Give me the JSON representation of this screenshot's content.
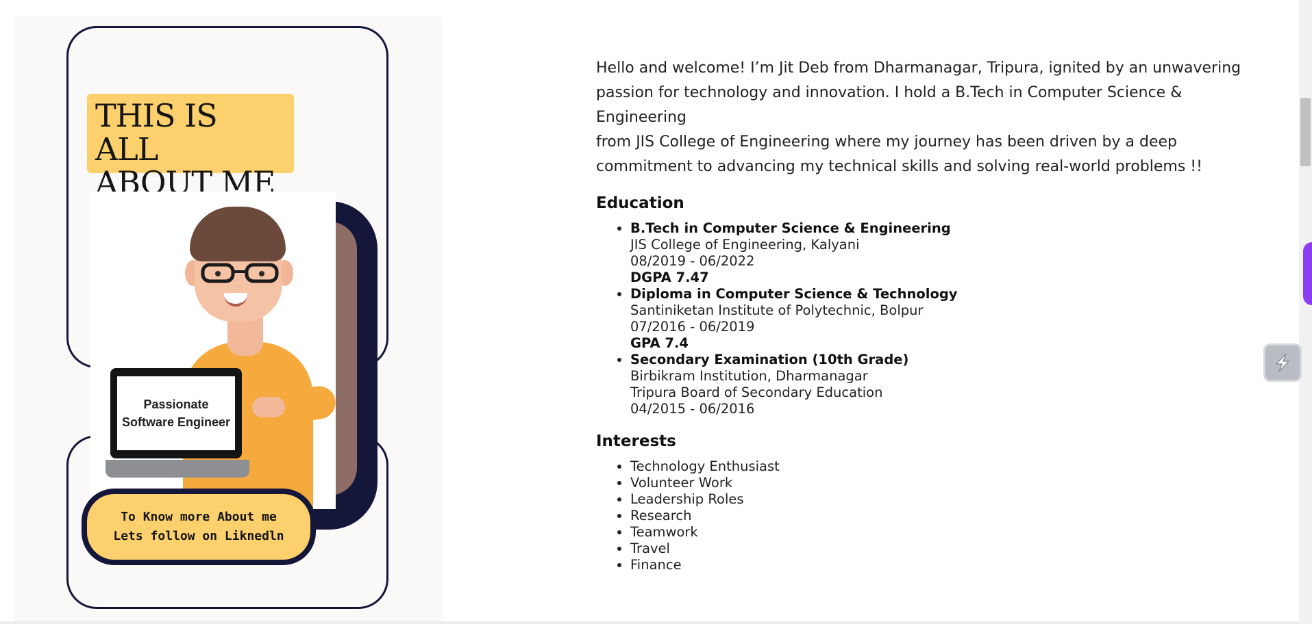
{
  "poster": {
    "headline": "THIS IS ALL\nABOUT ME !!",
    "laptop_text": "Passionate\nSoftware Engineer",
    "cta_text": "To Know more About me\nLets follow on Liknedln"
  },
  "about": {
    "intro_line1": "Hello and welcome! I’m Jit Deb from Dharmanagar, Tripura, ignited by an unwavering passion for technology and innovation. I hold a B.Tech in Computer Science & Engineering",
    "intro_line2": "from JIS College of Engineering where my journey has been driven by a deep commitment to advancing my technical skills and solving real-world problems !!"
  },
  "education": {
    "title": "Education",
    "items": [
      {
        "degree": "B.Tech in Computer Science & Engineering",
        "institution": "JIS College of Engineering, Kalyani",
        "dates": "08/2019 - 06/2022",
        "grade": "DGPA 7.47"
      },
      {
        "degree": "Diploma in Computer Science & Technology",
        "institution": "Santiniketan Institute of Polytechnic, Bolpur",
        "dates": "07/2016 - 06/2019",
        "grade": "GPA 7.4"
      },
      {
        "degree": "Secondary Examination (10th Grade)",
        "institution": "Birbikram Institution, Dharmanagar",
        "board": "Tripura Board of Secondary Education",
        "dates": "04/2015 - 06/2016"
      }
    ]
  },
  "interests": {
    "title": "Interests",
    "items": [
      "Technology Enthusiast",
      "Volunteer Work",
      "Leadership Roles",
      "Research",
      "Teamwork",
      "Travel",
      "Finance"
    ]
  },
  "colors": {
    "poster_yellow": "#fcd06c",
    "poster_navy": "#14163a",
    "side_tab_purple": "#8b3df2"
  },
  "icons": {
    "floating_button": "extension-logo-icon"
  }
}
